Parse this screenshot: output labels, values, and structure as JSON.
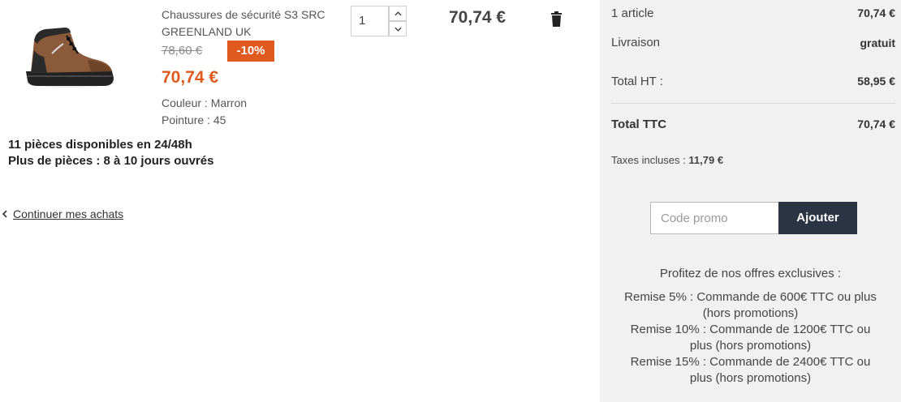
{
  "product": {
    "name": "Chaussures de sécurité S3 SRC GREENLAND UK",
    "old_price": "78,60 €",
    "discount": "-10%",
    "new_price": "70,74 €",
    "color_label": "Couleur : Marron",
    "size_label": "Pointure : 45",
    "image_icon": "safety-boot-image"
  },
  "stock": {
    "line1": "11 pièces disponibles en 24/48h",
    "line2": "Plus de pièces : 8 à 10 jours ouvrés"
  },
  "quantity": {
    "value": "1"
  },
  "line_total": "70,74 €",
  "continue_link": "Continuer mes achats",
  "summary": {
    "articles_label": "1 article",
    "articles_value": "70,74 €",
    "shipping_label": "Livraison",
    "shipping_value": "gratuit",
    "total_ht_label": "Total HT :",
    "total_ht_value": "58,95 €",
    "total_ttc_label": "Total TTC",
    "total_ttc_value": "70,74 €",
    "taxes_label": "Taxes incluses :",
    "taxes_value": "11,79 €"
  },
  "promo": {
    "placeholder": "Code promo",
    "button_label": "Ajouter"
  },
  "offers": {
    "title": "Profitez de nos offres exclusives :",
    "lines": [
      [
        "Remise 5% : Commande de 600€ TTC ou plus",
        "(hors promotions)"
      ],
      [
        "Remise 10% : Commande de 1200€ TTC ou",
        "plus (hors promotions)"
      ],
      [
        "Remise 15% : Commande de 2400€ TTC ou",
        "plus (hors promotions)"
      ]
    ]
  },
  "colors": {
    "accent": "#e05a1e",
    "button_dark": "#2b3443",
    "panel_bg": "#f1f1f1"
  }
}
